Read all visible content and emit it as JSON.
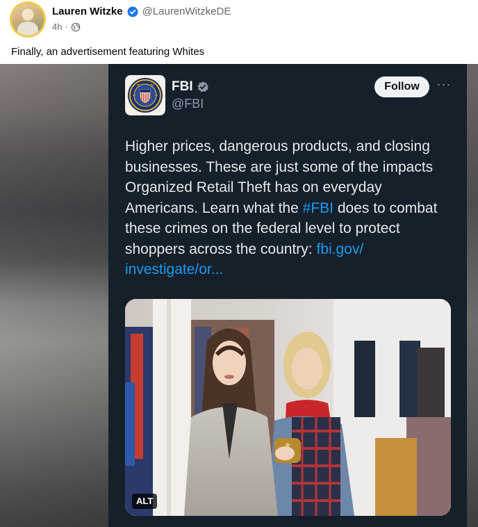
{
  "post": {
    "author_name": "Lauren Witzke",
    "handle": "@LaurenWitzkeDE",
    "time": "4h",
    "separator": "·",
    "text": "Finally, an advertisement featuring Whites"
  },
  "tweet": {
    "name": "FBI",
    "handle": "@FBI",
    "follow_label": "Follow",
    "more_label": "···",
    "text_part1": "Higher prices, dangerous products, and closing businesses. These are just some of the impacts Organized Retail Theft has on everyday Americans. Learn what the ",
    "hashtag": "#FBI",
    "text_part2": " does to combat these crimes on the federal level to protect shoppers across the country: ",
    "link": "fbi.gov/ investigate/or...",
    "image_badge": "ALT"
  },
  "colors": {
    "verified_blue": "#1877f2",
    "tweet_bg": "#15202b",
    "link_blue": "#1d9bf0",
    "avatar_ring": "#f2c94c"
  },
  "icons": {
    "verified": "verified-badge-icon",
    "audience": "globe-icon",
    "more": "more-options-icon",
    "seal": "fbi-seal-logo"
  }
}
